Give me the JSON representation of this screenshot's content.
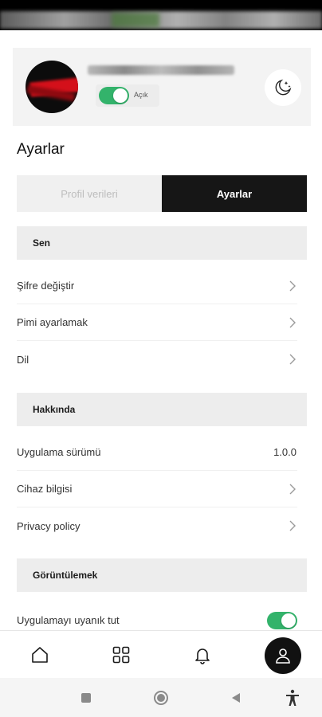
{
  "profile": {
    "status_label": "Açık",
    "moon_icon": "moon-stars-icon"
  },
  "page_title": "Ayarlar",
  "segment": {
    "tabs": [
      {
        "label": "Profil verileri",
        "active": false
      },
      {
        "label": "Ayarlar",
        "active": true
      }
    ]
  },
  "sections": {
    "sen": {
      "title": "Sen",
      "items": [
        {
          "label": "Şifre değiştir"
        },
        {
          "label": "Pimi ayarlamak"
        },
        {
          "label": "Dil"
        }
      ]
    },
    "hakkinda": {
      "title": "Hakkında",
      "items": [
        {
          "label": "Uygulama sürümü",
          "value": "1.0.0"
        },
        {
          "label": "Cihaz bilgisi"
        },
        {
          "label": "Privacy policy"
        }
      ]
    },
    "goruntulemek": {
      "title": "Görüntülemek",
      "items": [
        {
          "label": "Uygulamayı uyanık tut",
          "toggle_on": true
        }
      ]
    }
  },
  "colors": {
    "accent_green": "#33b36b",
    "dark": "#161616"
  },
  "bottom_nav": [
    "home-icon",
    "grid-icon",
    "bell-icon",
    "profile-icon"
  ],
  "system_nav": [
    "recents-icon",
    "home-circle-icon",
    "back-icon",
    "accessibility-icon"
  ]
}
